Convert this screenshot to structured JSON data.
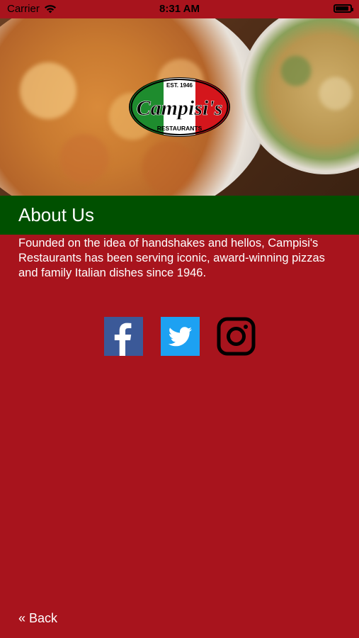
{
  "status_bar": {
    "carrier": "Carrier",
    "time": "8:31 AM",
    "battery_level": 0.9
  },
  "logo": {
    "est": "EST. 1946",
    "name": "Campisi's",
    "subtitle": "RESTAURANTS"
  },
  "about": {
    "title": "About Us",
    "description": "Founded on the idea of handshakes and hellos, Campisi's Restaurants has been serving iconic, award-winning pizzas and family Italian dishes since 1946."
  },
  "social": [
    {
      "name": "Facebook",
      "icon": "facebook-icon"
    },
    {
      "name": "Twitter",
      "icon": "twitter-icon"
    },
    {
      "name": "Instagram",
      "icon": "instagram-icon"
    }
  ],
  "nav": {
    "back_label": "« Back"
  },
  "colors": {
    "background": "#a8141d",
    "header_green": "#005000",
    "facebook": "#3b5998",
    "twitter": "#1da1f2"
  }
}
